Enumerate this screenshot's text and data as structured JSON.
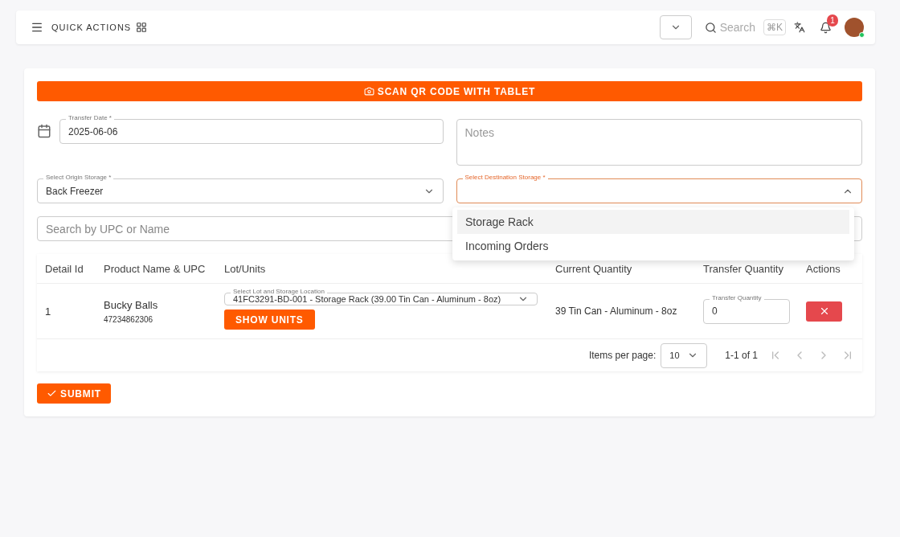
{
  "topbar": {
    "quick_actions": "QUICK ACTIONS",
    "search_placeholder": "Search",
    "shortcut": "⌘K",
    "notification_count": "1",
    "online": true
  },
  "form": {
    "scan_button": "SCAN QR CODE WITH TABLET",
    "transfer_date": {
      "label": "Transfer Date *",
      "value": "2025-06-06"
    },
    "notes": {
      "placeholder": "Notes"
    },
    "origin": {
      "label": "Select Origin Storage *",
      "value": "Back Freezer"
    },
    "destination": {
      "label": "Select Destination Storage *",
      "expanded": true,
      "options": [
        {
          "label": "Storage Rack",
          "selected": true
        },
        {
          "label": "Incoming Orders",
          "selected": false
        }
      ]
    },
    "search": {
      "placeholder": "Search by UPC or Name"
    }
  },
  "table": {
    "columns": [
      "Detail Id",
      "Product Name & UPC",
      "Lot/Units",
      "Current Quantity",
      "Transfer Quantity",
      "Actions"
    ],
    "rows": [
      {
        "id": "1",
        "name": "Bucky Balls",
        "upc": "47234862306",
        "lot_label": "Select Lot and Storage Location",
        "lot_value": "41FC3291-BD-001 - Storage Rack (39.00 Tin Can - Aluminum - 8oz)",
        "show_units": "SHOW UNITS",
        "current": "39 Tin Can - Aluminum - 8oz",
        "qty_label": "Transfer Quantity",
        "qty_value": "0"
      }
    ]
  },
  "pagination": {
    "items_per_page_label": "Items per page:",
    "per_page": "10",
    "range": "1-1 of 1"
  },
  "submit": "SUBMIT"
}
